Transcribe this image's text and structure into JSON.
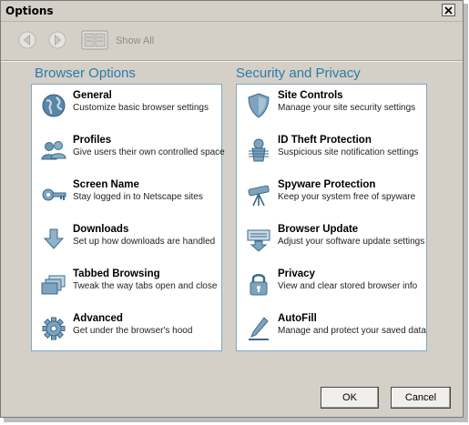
{
  "window": {
    "title": "Options"
  },
  "toolbar": {
    "show_all_label": "Show All"
  },
  "browser_options": {
    "heading": "Browser Options",
    "items": [
      {
        "icon": "globe-icon",
        "title": "General",
        "desc": "Customize basic browser settings"
      },
      {
        "icon": "users-icon",
        "title": "Profiles",
        "desc": "Give users their own controlled space"
      },
      {
        "icon": "key-icon",
        "title": "Screen Name",
        "desc": "Stay logged in to Netscape sites"
      },
      {
        "icon": "download-arrow-icon",
        "title": "Downloads",
        "desc": "Set up how downloads are handled"
      },
      {
        "icon": "tabs-icon",
        "title": "Tabbed Browsing",
        "desc": "Tweak the way tabs open and close"
      },
      {
        "icon": "gear-icon",
        "title": "Advanced",
        "desc": "Get under the browser's hood"
      }
    ]
  },
  "security_privacy": {
    "heading": "Security and Privacy",
    "items": [
      {
        "icon": "shield-icon",
        "title": "Site Controls",
        "desc": "Manage your site security settings"
      },
      {
        "icon": "id-badge-icon",
        "title": "ID Theft Protection",
        "desc": "Suspicious site notification settings"
      },
      {
        "icon": "telescope-icon",
        "title": "Spyware Protection",
        "desc": "Keep your system free of spyware"
      },
      {
        "icon": "update-icon",
        "title": "Browser Update",
        "desc": "Adjust your software update settings"
      },
      {
        "icon": "lock-icon",
        "title": "Privacy",
        "desc": "View and clear stored browser info"
      },
      {
        "icon": "pen-icon",
        "title": "AutoFill",
        "desc": "Manage and protect your saved data"
      }
    ]
  },
  "buttons": {
    "ok": "OK",
    "cancel": "Cancel"
  },
  "colors": {
    "accent": "#2c7aa8",
    "panel_border": "#7fa9c4",
    "window_bg": "#d4d0c8"
  }
}
